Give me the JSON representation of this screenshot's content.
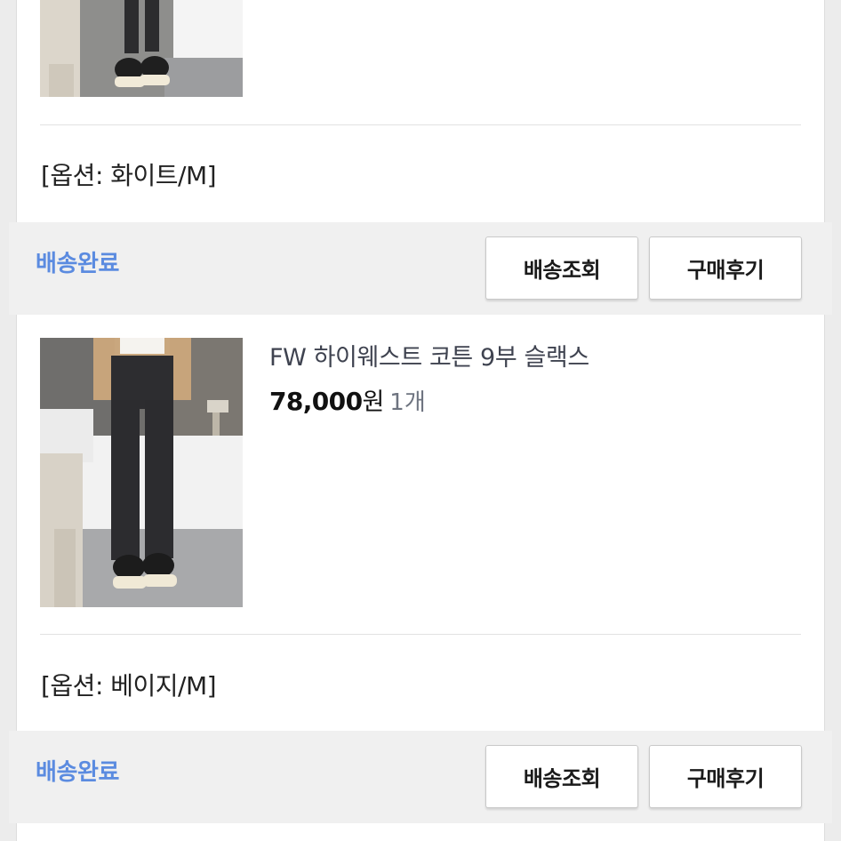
{
  "items": [
    {
      "option": "[옵션: 화이트/M]",
      "status": "배송완료",
      "track_label": "배송조회",
      "review_label": "구매후기"
    },
    {
      "product_name": "FW 하이웨스트 코튼 9부 슬랙스",
      "price": "78,000",
      "currency": "원",
      "quantity": "1개",
      "option": "[옵션: 베이지/M]",
      "status": "배송완료",
      "track_label": "배송조회",
      "review_label": "구매후기"
    }
  ],
  "colors": {
    "status": "#5b8be0",
    "background": "#ececec",
    "card": "#ffffff"
  }
}
